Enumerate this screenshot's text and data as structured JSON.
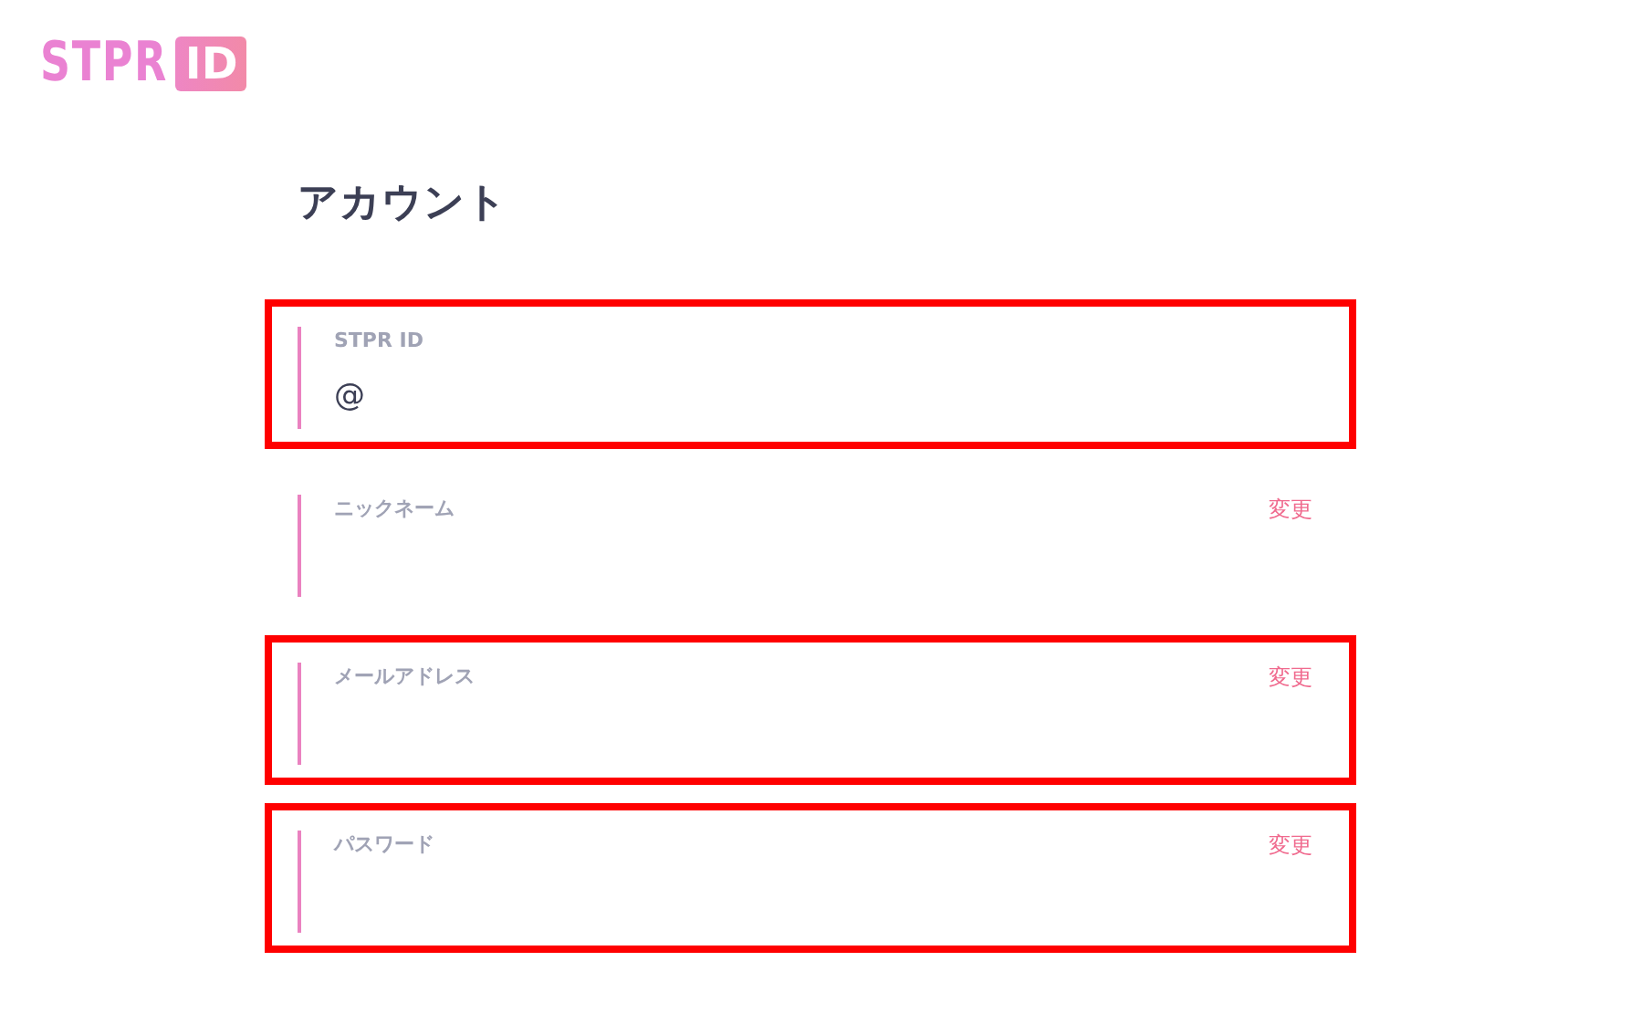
{
  "logo": {
    "text": "STPR",
    "badge": "ID"
  },
  "title": "アカウント",
  "fields": [
    {
      "label": "STPR ID",
      "value": "@",
      "highlighted": true
    },
    {
      "label": "ニックネーム",
      "action": "変更",
      "highlighted": false
    },
    {
      "label": "メールアドレス",
      "action": "変更",
      "highlighted": true
    },
    {
      "label": "パスワード",
      "action": "変更",
      "highlighted": true
    }
  ]
}
